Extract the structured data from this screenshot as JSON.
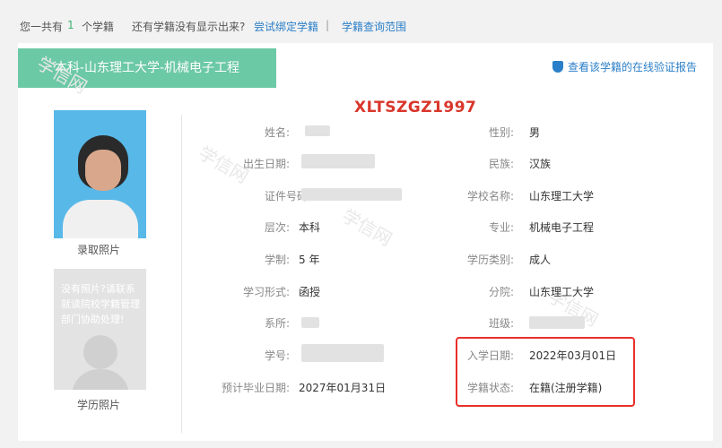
{
  "topbar": {
    "prefix": "您一共有",
    "count": "1",
    "suffix": "个学籍",
    "question": "还有学籍没有显示出来?",
    "bind_link": "尝试绑定学籍",
    "separator": "|",
    "scope_link": "学籍查询范围"
  },
  "card": {
    "tab_title": "本科-山东理工大学-机械电子工程",
    "verify_link": "查看该学籍的在线验证报告",
    "watermark_code": "XLTSZGZ1997",
    "admission_photo_caption": "录取照片",
    "no_photo_text": "没有照片?请联系就读院校学籍管理部门协助处理!",
    "diploma_photo_caption": "学历照片"
  },
  "fields": {
    "name": {
      "label": "姓名:"
    },
    "gender": {
      "label": "性别:",
      "value": "男"
    },
    "birth": {
      "label": "出生日期:"
    },
    "ethnicity": {
      "label": "民族:",
      "value": "汉族"
    },
    "id_number": {
      "label": "证件号码"
    },
    "school": {
      "label": "学校名称:",
      "value": "山东理工大学"
    },
    "level": {
      "label": "层次:",
      "value": "本科"
    },
    "major": {
      "label": "专业:",
      "value": "机械电子工程"
    },
    "duration": {
      "label": "学制:",
      "value": "5 年"
    },
    "edu_type": {
      "label": "学历类别:",
      "value": "成人"
    },
    "study_form": {
      "label": "学习形式:",
      "value": "函授"
    },
    "branch": {
      "label": "分院:",
      "value": "山东理工大学"
    },
    "department": {
      "label": "系所:"
    },
    "class": {
      "label": "班级:"
    },
    "student_no": {
      "label": "学号:"
    },
    "enroll_date": {
      "label": "入学日期:",
      "value": "2022年03月01日"
    },
    "grad_date": {
      "label": "预计毕业日期:",
      "value": "2027年01月31日"
    },
    "status": {
      "label": "学籍状态:",
      "value": "在籍(注册学籍)"
    }
  },
  "colors": {
    "tab": "#6cc9a6",
    "link": "#2b7fc8",
    "highlight": "#e8302b"
  }
}
